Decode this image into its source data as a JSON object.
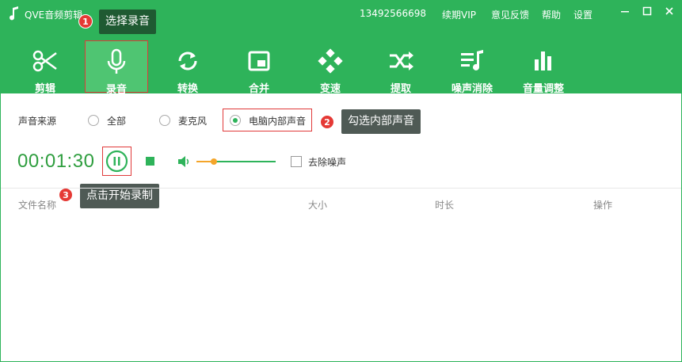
{
  "titlebar": {
    "app_title": "QVE音频剪辑",
    "phone": "13492566698",
    "links": [
      "续期VIP",
      "意见反馈",
      "帮助",
      "设置"
    ]
  },
  "toolbar": {
    "items": [
      {
        "label": "剪辑",
        "icon": "scissors-icon"
      },
      {
        "label": "录音",
        "icon": "microphone-icon",
        "active": true
      },
      {
        "label": "转换",
        "icon": "convert-icon"
      },
      {
        "label": "合并",
        "icon": "merge-icon"
      },
      {
        "label": "变速",
        "icon": "speed-icon"
      },
      {
        "label": "提取",
        "icon": "extract-icon"
      },
      {
        "label": "噪声消除",
        "icon": "noise-removal-icon"
      },
      {
        "label": "音量调整",
        "icon": "volume-adjust-icon"
      }
    ]
  },
  "source": {
    "label": "声音来源",
    "options": [
      "全部",
      "麦克风",
      "电脑内部声音"
    ],
    "selected": "电脑内部声音"
  },
  "recorder": {
    "timer": "00:01:30",
    "volume_level": 0.22,
    "denoise_label": "去除噪声",
    "denoise_checked": false
  },
  "table": {
    "columns": [
      "文件名称",
      "大小",
      "时长",
      "操作"
    ]
  },
  "callouts": [
    {
      "number": "1",
      "text": "选择录音"
    },
    {
      "number": "2",
      "text": "勾选内部声音"
    },
    {
      "number": "3",
      "text": "点击开始录制"
    }
  ],
  "colors": {
    "brand_green": "#2eb35a",
    "highlight_red": "#e03a3a",
    "timer_green": "#2f9e3f",
    "slider_orange": "#f4a52a"
  }
}
